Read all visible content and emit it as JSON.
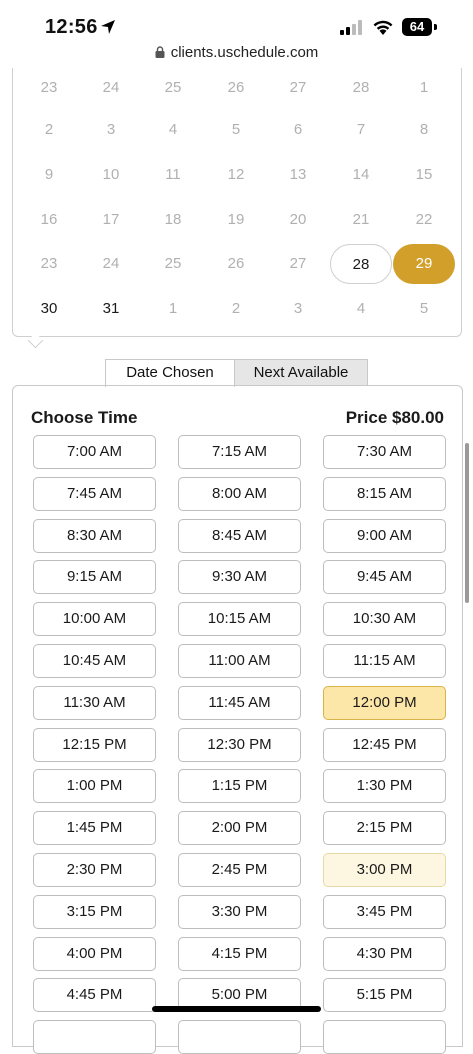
{
  "status_bar": {
    "time": "12:56",
    "battery": "64"
  },
  "browser": {
    "url": "clients.uschedule.com"
  },
  "calendar": {
    "weeks": [
      [
        {
          "d": "23",
          "s": "muted"
        },
        {
          "d": "24",
          "s": "muted"
        },
        {
          "d": "25",
          "s": "muted"
        },
        {
          "d": "26",
          "s": "muted"
        },
        {
          "d": "27",
          "s": "muted"
        },
        {
          "d": "28",
          "s": "muted"
        },
        {
          "d": "1",
          "s": "muted"
        }
      ],
      [
        {
          "d": "2",
          "s": "muted"
        },
        {
          "d": "3",
          "s": "muted"
        },
        {
          "d": "4",
          "s": "muted"
        },
        {
          "d": "5",
          "s": "muted"
        },
        {
          "d": "6",
          "s": "muted"
        },
        {
          "d": "7",
          "s": "muted"
        },
        {
          "d": "8",
          "s": "muted"
        }
      ],
      [
        {
          "d": "9",
          "s": "muted"
        },
        {
          "d": "10",
          "s": "muted"
        },
        {
          "d": "11",
          "s": "muted"
        },
        {
          "d": "12",
          "s": "muted"
        },
        {
          "d": "13",
          "s": "muted"
        },
        {
          "d": "14",
          "s": "muted"
        },
        {
          "d": "15",
          "s": "muted"
        }
      ],
      [
        {
          "d": "16",
          "s": "muted"
        },
        {
          "d": "17",
          "s": "muted"
        },
        {
          "d": "18",
          "s": "muted"
        },
        {
          "d": "19",
          "s": "muted"
        },
        {
          "d": "20",
          "s": "muted"
        },
        {
          "d": "21",
          "s": "muted"
        },
        {
          "d": "22",
          "s": "muted"
        }
      ],
      [
        {
          "d": "23",
          "s": "muted"
        },
        {
          "d": "24",
          "s": "muted"
        },
        {
          "d": "25",
          "s": "muted"
        },
        {
          "d": "26",
          "s": "muted"
        },
        {
          "d": "27",
          "s": "muted"
        },
        {
          "d": "28",
          "s": "outlined"
        },
        {
          "d": "29",
          "s": "selected"
        }
      ],
      [
        {
          "d": "30",
          "s": "active"
        },
        {
          "d": "31",
          "s": "active"
        },
        {
          "d": "1",
          "s": "muted"
        },
        {
          "d": "2",
          "s": "muted"
        },
        {
          "d": "3",
          "s": "muted"
        },
        {
          "d": "4",
          "s": "muted"
        },
        {
          "d": "5",
          "s": "muted"
        }
      ]
    ]
  },
  "tabs": {
    "date_chosen": "Date Chosen",
    "next_available": "Next Available"
  },
  "panel": {
    "choose_time": "Choose Time",
    "price": "Price $80.00"
  },
  "time_slots": [
    {
      "t": "7:00 AM",
      "s": ""
    },
    {
      "t": "7:15 AM",
      "s": ""
    },
    {
      "t": "7:30 AM",
      "s": ""
    },
    {
      "t": "7:45 AM",
      "s": ""
    },
    {
      "t": "8:00 AM",
      "s": ""
    },
    {
      "t": "8:15 AM",
      "s": ""
    },
    {
      "t": "8:30 AM",
      "s": ""
    },
    {
      "t": "8:45 AM",
      "s": ""
    },
    {
      "t": "9:00 AM",
      "s": ""
    },
    {
      "t": "9:15 AM",
      "s": ""
    },
    {
      "t": "9:30 AM",
      "s": ""
    },
    {
      "t": "9:45 AM",
      "s": ""
    },
    {
      "t": "10:00 AM",
      "s": ""
    },
    {
      "t": "10:15 AM",
      "s": ""
    },
    {
      "t": "10:30 AM",
      "s": ""
    },
    {
      "t": "10:45 AM",
      "s": ""
    },
    {
      "t": "11:00 AM",
      "s": ""
    },
    {
      "t": "11:15 AM",
      "s": ""
    },
    {
      "t": "11:30 AM",
      "s": ""
    },
    {
      "t": "11:45 AM",
      "s": ""
    },
    {
      "t": "12:00 PM",
      "s": "picked"
    },
    {
      "t": "12:15 PM",
      "s": ""
    },
    {
      "t": "12:30 PM",
      "s": ""
    },
    {
      "t": "12:45 PM",
      "s": ""
    },
    {
      "t": "1:00 PM",
      "s": ""
    },
    {
      "t": "1:15 PM",
      "s": ""
    },
    {
      "t": "1:30 PM",
      "s": ""
    },
    {
      "t": "1:45 PM",
      "s": ""
    },
    {
      "t": "2:00 PM",
      "s": ""
    },
    {
      "t": "2:15 PM",
      "s": ""
    },
    {
      "t": "2:30 PM",
      "s": ""
    },
    {
      "t": "2:45 PM",
      "s": ""
    },
    {
      "t": "3:00 PM",
      "s": "soft"
    },
    {
      "t": "3:15 PM",
      "s": ""
    },
    {
      "t": "3:30 PM",
      "s": ""
    },
    {
      "t": "3:45 PM",
      "s": ""
    },
    {
      "t": "4:00 PM",
      "s": ""
    },
    {
      "t": "4:15 PM",
      "s": ""
    },
    {
      "t": "4:30 PM",
      "s": ""
    },
    {
      "t": "4:45 PM",
      "s": ""
    },
    {
      "t": "5:00 PM",
      "s": ""
    },
    {
      "t": "5:15 PM",
      "s": ""
    }
  ],
  "colors": {
    "selected_date": "#d2a02a",
    "picked_slot": "#fde7a8",
    "soft_slot": "#fdf7e1"
  }
}
